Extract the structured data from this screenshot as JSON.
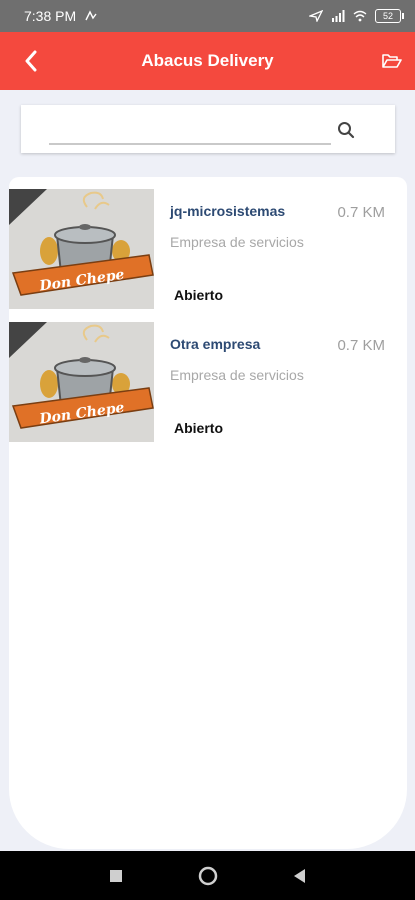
{
  "status_bar": {
    "time": "7:38 PM",
    "battery": "52"
  },
  "app_bar": {
    "title": "Abacus Delivery"
  },
  "search": {
    "value": "",
    "placeholder": ""
  },
  "businesses": [
    {
      "name": "jq-microsistemas",
      "distance": "0.7 KM",
      "category": "Empresa de servicios",
      "status": "Abierto"
    },
    {
      "name": "Otra empresa",
      "distance": "0.7 KM",
      "category": "Empresa de servicios",
      "status": "Abierto"
    }
  ],
  "logo_text": "Don Chepe",
  "colors": {
    "accent": "#f4493e",
    "name_text": "#2d4a73",
    "logo_banner": "#e07127"
  }
}
